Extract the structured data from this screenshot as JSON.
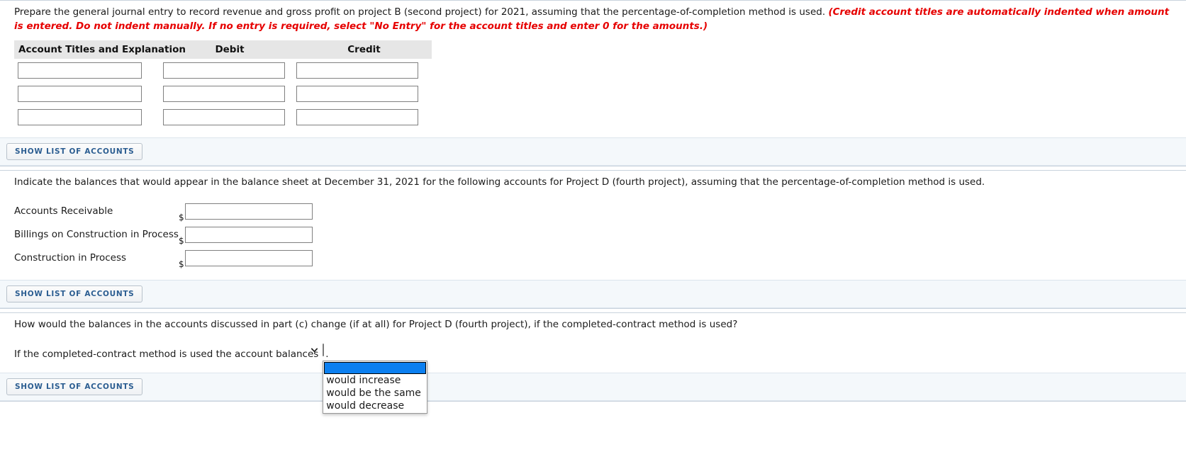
{
  "section_a": {
    "prompt_plain": "Prepare the general journal entry to record revenue and gross profit on project B (second project) for 2021, assuming that the percentage-of-completion method is used.",
    "prompt_red": "(Credit account titles are automatically indented when amount is entered. Do not indent manually. If no entry is required, select \"No Entry\" for the account titles and enter 0 for the amounts.)",
    "table": {
      "headers": [
        "Account Titles and Explanation",
        "Debit",
        "Credit"
      ],
      "rows": [
        {
          "account": "",
          "debit": "",
          "credit": ""
        },
        {
          "account": "",
          "debit": "",
          "credit": ""
        },
        {
          "account": "",
          "debit": "",
          "credit": ""
        }
      ]
    },
    "show_accounts_label": "SHOW LIST OF ACCOUNTS"
  },
  "section_b": {
    "prompt": "Indicate the balances that would appear in the balance sheet at December 31, 2021 for the following accounts for Project D (fourth project), assuming that the percentage-of-completion method is used.",
    "currency_symbol": "$",
    "balances": [
      {
        "label": "Accounts Receivable",
        "value": ""
      },
      {
        "label": "Billings on Construction in Process",
        "value": ""
      },
      {
        "label": "Construction in Process",
        "value": ""
      }
    ],
    "show_accounts_label": "SHOW LIST OF ACCOUNTS"
  },
  "section_c": {
    "prompt": "How would the balances in the accounts discussed in part (c) change (if at all) for Project D (fourth project), if the completed-contract method is used?",
    "answer_prefix": "If the completed-contract method is used the account balances",
    "answer_suffix": ".",
    "dropdown": {
      "selected": "",
      "expanded": true,
      "highlighted_index": 0,
      "options": [
        "",
        "would increase",
        "would be the same",
        "would decrease"
      ]
    },
    "show_accounts_label": "SHOW LIST OF ACCOUNTS"
  },
  "colors": {
    "red_hint": "#e60000",
    "header_bg": "#e6e6e6",
    "accounts_bar_bg": "#f4f8fb",
    "button_text": "#2b5d91",
    "dropdown_highlight": "#0b7ff0",
    "input_border": "#808080"
  }
}
